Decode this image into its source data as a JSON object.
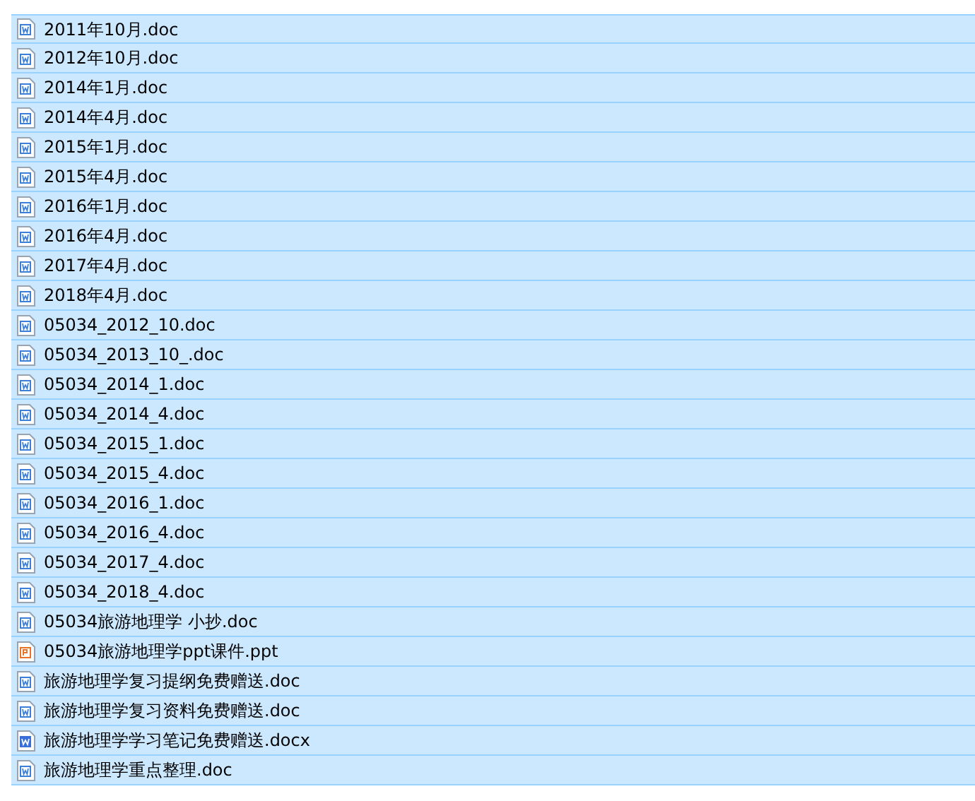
{
  "files": [
    {
      "name": "2011年10月.doc",
      "kind": "doc",
      "selected": true
    },
    {
      "name": "2012年10月.doc",
      "kind": "doc",
      "selected": true
    },
    {
      "name": "2014年1月.doc",
      "kind": "doc",
      "selected": true
    },
    {
      "name": "2014年4月.doc",
      "kind": "doc",
      "selected": true
    },
    {
      "name": "2015年1月.doc",
      "kind": "doc",
      "selected": true
    },
    {
      "name": "2015年4月.doc",
      "kind": "doc",
      "selected": true
    },
    {
      "name": "2016年1月.doc",
      "kind": "doc",
      "selected": true
    },
    {
      "name": "2016年4月.doc",
      "kind": "doc",
      "selected": true
    },
    {
      "name": "2017年4月.doc",
      "kind": "doc",
      "selected": true
    },
    {
      "name": "2018年4月.doc",
      "kind": "doc",
      "selected": true
    },
    {
      "name": "05034_2012_10.doc",
      "kind": "doc",
      "selected": true
    },
    {
      "name": "05034_2013_10_.doc",
      "kind": "doc",
      "selected": true
    },
    {
      "name": "05034_2014_1.doc",
      "kind": "doc",
      "selected": true
    },
    {
      "name": "05034_2014_4.doc",
      "kind": "doc",
      "selected": true
    },
    {
      "name": "05034_2015_1.doc",
      "kind": "doc",
      "selected": true
    },
    {
      "name": "05034_2015_4.doc",
      "kind": "doc",
      "selected": true
    },
    {
      "name": "05034_2016_1.doc",
      "kind": "doc",
      "selected": true
    },
    {
      "name": "05034_2016_4.doc",
      "kind": "doc",
      "selected": true
    },
    {
      "name": "05034_2017_4.doc",
      "kind": "doc",
      "selected": true
    },
    {
      "name": "05034_2018_4.doc",
      "kind": "doc",
      "selected": true
    },
    {
      "name": "05034旅游地理学 小抄.doc",
      "kind": "doc",
      "selected": true
    },
    {
      "name": "05034旅游地理学ppt课件.ppt",
      "kind": "ppt",
      "selected": true
    },
    {
      "name": "旅游地理学复习提纲免费赠送.doc",
      "kind": "doc",
      "selected": true
    },
    {
      "name": "旅游地理学复习资料免费赠送.doc",
      "kind": "doc",
      "selected": true
    },
    {
      "name": "旅游地理学学习笔记免费赠送.docx",
      "kind": "docx",
      "selected": true
    },
    {
      "name": "旅游地理学重点整理.doc",
      "kind": "doc",
      "selected": true
    }
  ]
}
